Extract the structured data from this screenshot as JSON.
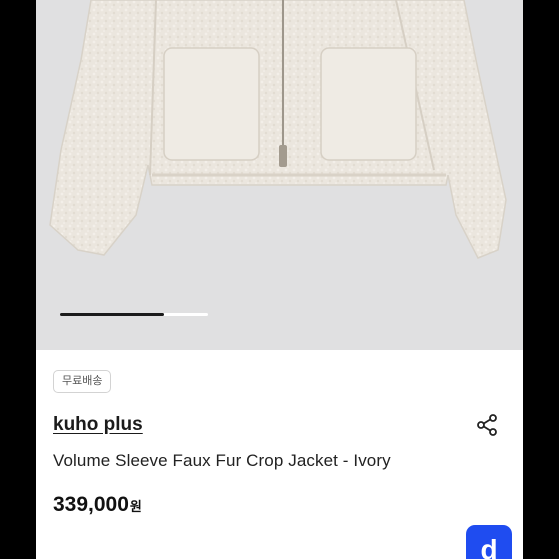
{
  "image_carousel": {
    "progress": 0.7
  },
  "product": {
    "shipping_badge": "무료배송",
    "brand": "kuho plus",
    "title": "Volume Sleeve Faux Fur Crop Jacket - Ivory",
    "price": "339,000",
    "currency": "원"
  },
  "floating_button": {
    "letter": "d",
    "color": "#1f4cf0"
  },
  "icons": {
    "share": "share-icon"
  }
}
